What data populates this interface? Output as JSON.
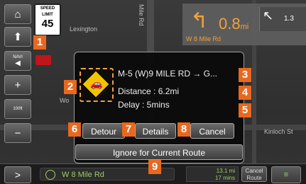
{
  "map": {
    "label_lexington": "Lexington",
    "label_mile_rd_vertical": "Mile Rd",
    "label_kinloch": "Kinloch St",
    "label_wo": "Wo"
  },
  "speed_limit": {
    "line1": "SPEED",
    "line2": "LIMIT",
    "value": "45"
  },
  "left_buttons": {
    "home": "⌂",
    "nav": "NAVI",
    "plus": "+",
    "scale": "100ft",
    "minus": "−"
  },
  "turn": {
    "distance": "0.8",
    "unit": "mi",
    "street": "W 8 Mile Rd",
    "next_distance": "1.3"
  },
  "dialog": {
    "route": "M-5 (W)9 MILE RD → G...",
    "distance": "Distance : 6.2mi",
    "delay": "Delay : 5mins",
    "detour_label": "Detour",
    "details_label": "Details",
    "cancel_label": "Cancel",
    "ignore_label": "Ignore for Current Route"
  },
  "bottom": {
    "arrow": ">",
    "street": "W 8 Mile Rd",
    "time_dist": "13.1 mi",
    "time_mins": "17 mins",
    "cancel_line1": "Cancel",
    "cancel_line2": "Route",
    "menu": "≡"
  },
  "badges": [
    "1",
    "2",
    "3",
    "4",
    "5",
    "6",
    "7",
    "8",
    "9"
  ],
  "colors": {
    "accent": "#f2a23a",
    "badge": "#e8681f",
    "route_green": "#9ccc65"
  }
}
